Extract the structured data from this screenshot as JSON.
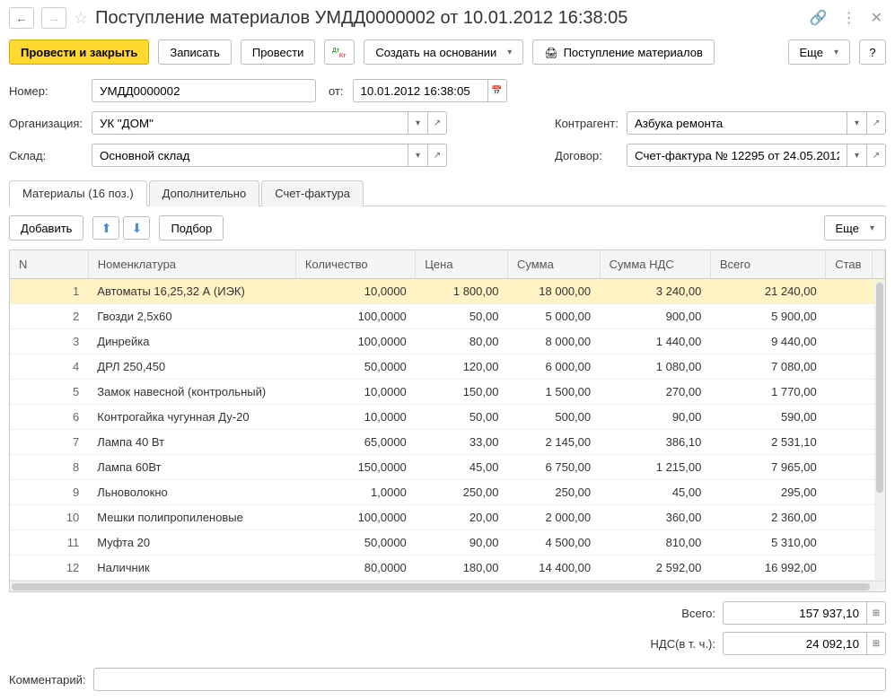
{
  "header": {
    "title": "Поступление материалов УМДД0000002 от 10.01.2012 16:38:05"
  },
  "toolbar": {
    "post_close": "Провести и закрыть",
    "save": "Записать",
    "post": "Провести",
    "create_based": "Создать на основании",
    "receipt": "Поступление материалов",
    "more": "Еще",
    "help": "?"
  },
  "form": {
    "number_label": "Номер:",
    "number_value": "УМДД0000002",
    "date_label": "от:",
    "date_value": "10.01.2012 16:38:05",
    "org_label": "Организация:",
    "org_value": "УК \"ДОМ\"",
    "warehouse_label": "Склад:",
    "warehouse_value": "Основной склад",
    "counterparty_label": "Контрагент:",
    "counterparty_value": "Азбука ремонта",
    "contract_label": "Договор:",
    "contract_value": "Счет-фактура № 12295 от 24.05.2012"
  },
  "tabs": {
    "materials": "Материалы (16 поз.)",
    "additional": "Дополнительно",
    "invoice": "Счет-фактура"
  },
  "tab_toolbar": {
    "add": "Добавить",
    "pick": "Подбор",
    "more": "Еще"
  },
  "table": {
    "headers": {
      "n": "N",
      "item": "Номенклатура",
      "qty": "Количество",
      "price": "Цена",
      "sum": "Сумма",
      "vat_sum": "Сумма НДС",
      "total": "Всего",
      "rate": "Став"
    },
    "rows": [
      {
        "n": "1",
        "item": "Автоматы 16,25,32 А (ИЭК)",
        "qty": "10,0000",
        "price": "1 800,00",
        "sum": "18 000,00",
        "vat": "3 240,00",
        "total": "21 240,00"
      },
      {
        "n": "2",
        "item": "Гвозди 2,5х60",
        "qty": "100,0000",
        "price": "50,00",
        "sum": "5 000,00",
        "vat": "900,00",
        "total": "5 900,00"
      },
      {
        "n": "3",
        "item": "Динрейка",
        "qty": "100,0000",
        "price": "80,00",
        "sum": "8 000,00",
        "vat": "1 440,00",
        "total": "9 440,00"
      },
      {
        "n": "4",
        "item": "ДРЛ 250,450",
        "qty": "50,0000",
        "price": "120,00",
        "sum": "6 000,00",
        "vat": "1 080,00",
        "total": "7 080,00"
      },
      {
        "n": "5",
        "item": "Замок навесной (контрольный)",
        "qty": "10,0000",
        "price": "150,00",
        "sum": "1 500,00",
        "vat": "270,00",
        "total": "1 770,00"
      },
      {
        "n": "6",
        "item": "Контрогайка чугунная Ду-20",
        "qty": "10,0000",
        "price": "50,00",
        "sum": "500,00",
        "vat": "90,00",
        "total": "590,00"
      },
      {
        "n": "7",
        "item": "Лампа 40 Вт",
        "qty": "65,0000",
        "price": "33,00",
        "sum": "2 145,00",
        "vat": "386,10",
        "total": "2 531,10"
      },
      {
        "n": "8",
        "item": "Лампа 60Вт",
        "qty": "150,0000",
        "price": "45,00",
        "sum": "6 750,00",
        "vat": "1 215,00",
        "total": "7 965,00"
      },
      {
        "n": "9",
        "item": "Льноволокно",
        "qty": "1,0000",
        "price": "250,00",
        "sum": "250,00",
        "vat": "45,00",
        "total": "295,00"
      },
      {
        "n": "10",
        "item": "Мешки полипропиленовые",
        "qty": "100,0000",
        "price": "20,00",
        "sum": "2 000,00",
        "vat": "360,00",
        "total": "2 360,00"
      },
      {
        "n": "11",
        "item": "Муфта 20",
        "qty": "50,0000",
        "price": "90,00",
        "sum": "4 500,00",
        "vat": "810,00",
        "total": "5 310,00"
      },
      {
        "n": "12",
        "item": "Наличник",
        "qty": "80,0000",
        "price": "180,00",
        "sum": "14 400,00",
        "vat": "2 592,00",
        "total": "16 992,00"
      }
    ]
  },
  "totals": {
    "total_label": "Всего:",
    "total_value": "157 937,10",
    "vat_label": "НДС(в т. ч.):",
    "vat_value": "24 092,10"
  },
  "comment": {
    "label": "Комментарий:",
    "value": ""
  }
}
